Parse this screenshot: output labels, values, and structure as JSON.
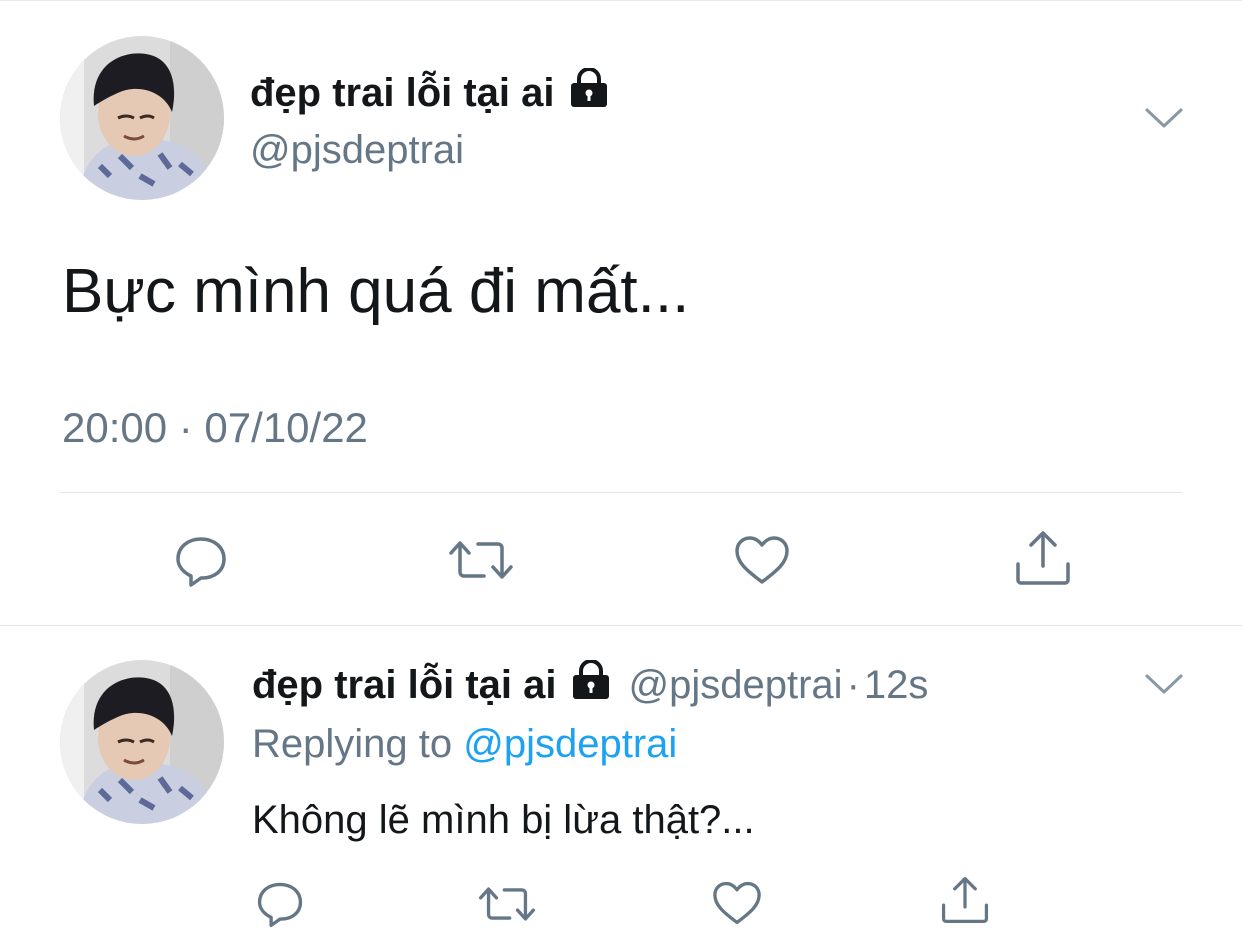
{
  "tweet": {
    "author_name": "đẹp trai lỗi tại ai",
    "author_handle": "@pjsdeptrai",
    "text": "Bực mình quá đi mất...",
    "timestamp": "20:00 · 07/10/22",
    "protected_icon": "lock-icon",
    "menu_icon": "chevron-down-icon",
    "actions": [
      "reply-icon",
      "retweet-icon",
      "like-icon",
      "share-icon"
    ]
  },
  "reply": {
    "author_name": "đẹp trai lỗi tại ai",
    "author_handle": "@pjsdeptrai",
    "separator": "·",
    "time": "12s",
    "replying_prefix": "Replying to",
    "replying_to": "@pjsdeptrai",
    "text": "Không lẽ mình bị lừa thật?...",
    "actions": [
      "reply-icon",
      "retweet-icon",
      "like-icon",
      "share-icon"
    ]
  },
  "colors": {
    "text": "#14171a",
    "secondary": "#657786",
    "link": "#1da1f2",
    "divider": "#e1e8ed"
  }
}
